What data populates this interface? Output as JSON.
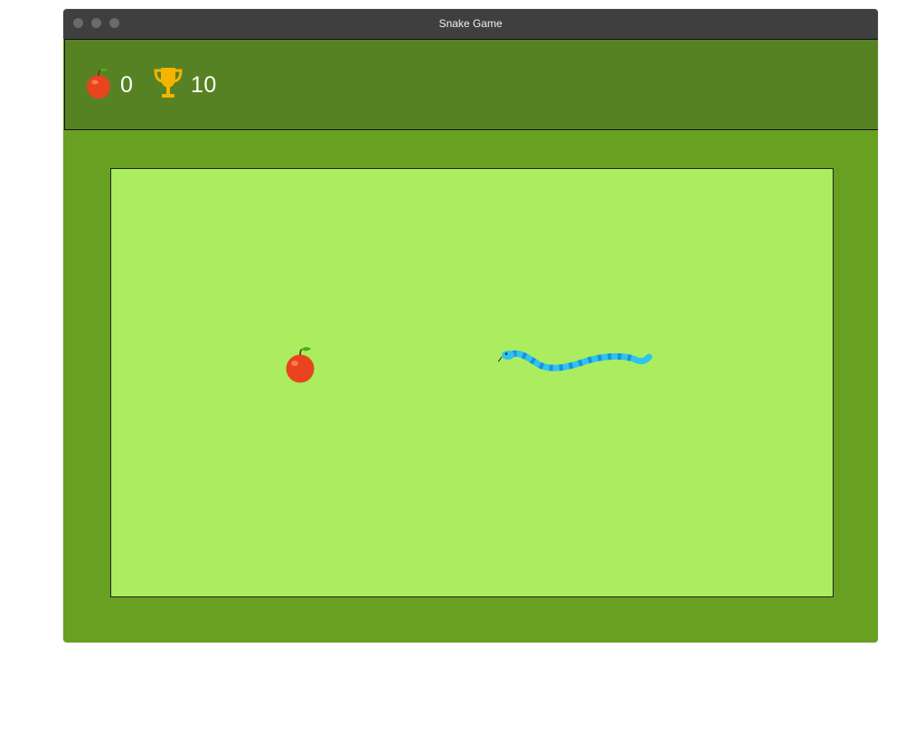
{
  "window": {
    "title": "Snake Game",
    "controls": [
      "close",
      "minimize",
      "maximize"
    ]
  },
  "hud": {
    "score": "0",
    "score_icon": "apple-icon",
    "best": "10",
    "best_icon": "trophy-icon"
  },
  "board": {
    "food": "apple",
    "player": "snake",
    "snake_direction": "left"
  },
  "colors": {
    "titlebar": "#3f3f3f",
    "window_bg": "#68a022",
    "hud_bg": "#578223",
    "field_bg": "#abed5f",
    "apple_red": "#e8441e",
    "apple_leaf": "#3fb21a",
    "trophy_gold": "#f4b400",
    "snake_blue": "#2ec4ee",
    "snake_stripe": "#1f8fe0"
  }
}
